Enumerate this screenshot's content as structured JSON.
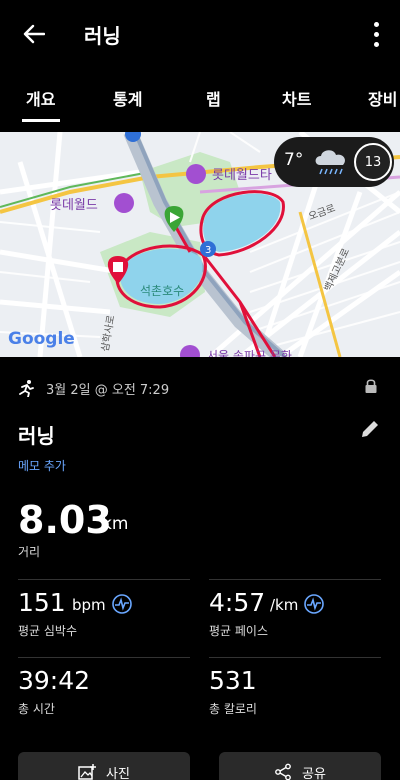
{
  "header": {
    "title": "러닝"
  },
  "tabs": [
    "개요",
    "통계",
    "랩",
    "차트",
    "장비"
  ],
  "map": {
    "labels": {
      "lotte_world": "롯데월드",
      "lotte_world_tower": "롯데월드타",
      "lake": "석촌호수",
      "olympic_ro": "오금로",
      "baekje": "백제고분로",
      "samhak": "삼학사로",
      "google": "Google",
      "route_badge": "3",
      "songpa": "서울 송파구 문화"
    }
  },
  "weather": {
    "temp": "7°",
    "uv": "13"
  },
  "activity": {
    "date": "3월 2일 @ 오전 7:29",
    "name": "러닝",
    "memo_label": "메모 추가"
  },
  "stats": {
    "distance": {
      "value": "8.03",
      "unit": "km",
      "label": "거리"
    },
    "heart_rate": {
      "value": "151",
      "unit": "bpm",
      "label": "평균 심박수"
    },
    "pace": {
      "value": "4:57",
      "unit": "/km",
      "label": "평균 페이스"
    },
    "time": {
      "value": "39:42",
      "label": "총 시간"
    },
    "calories": {
      "value": "531",
      "label": "총 칼로리"
    }
  },
  "actions": {
    "photo": "사진",
    "share": "공유"
  },
  "colors": {
    "accent": "#6aa7ff",
    "route": "#e0103a",
    "water": "#8fd3ec"
  }
}
